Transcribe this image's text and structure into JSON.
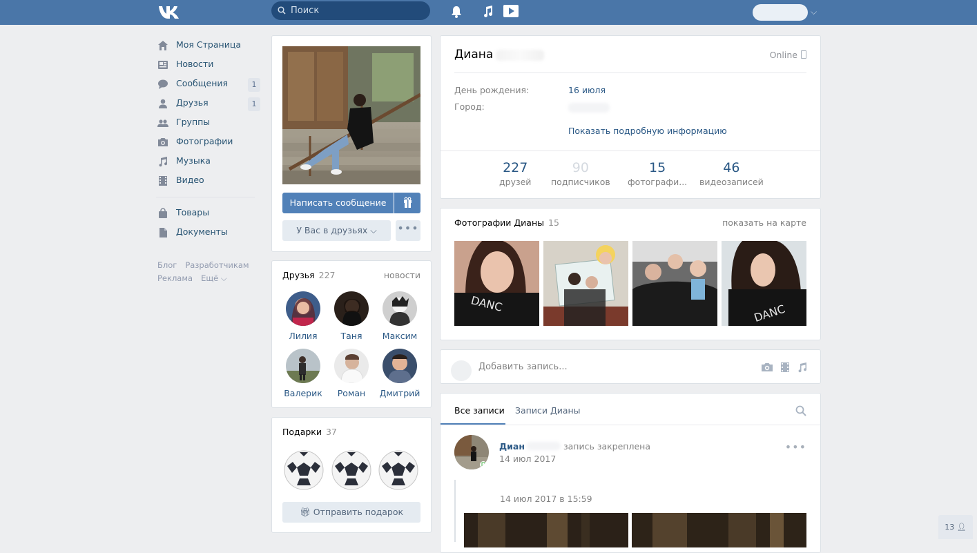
{
  "header": {
    "search_placeholder": "Поиск"
  },
  "nav": {
    "items": [
      {
        "label": "Моя Страница",
        "icon": "home-icon"
      },
      {
        "label": "Новости",
        "icon": "news-icon"
      },
      {
        "label": "Сообщения",
        "icon": "messages-icon",
        "count": "1"
      },
      {
        "label": "Друзья",
        "icon": "friends-icon",
        "count": "1"
      },
      {
        "label": "Группы",
        "icon": "groups-icon"
      },
      {
        "label": "Фотографии",
        "icon": "camera-icon"
      },
      {
        "label": "Музыка",
        "icon": "music-icon"
      },
      {
        "label": "Видео",
        "icon": "video-icon"
      }
    ],
    "items2": [
      {
        "label": "Товары",
        "icon": "bag-icon"
      },
      {
        "label": "Документы",
        "icon": "document-icon"
      }
    ],
    "footer": [
      "Блог",
      "Разработчикам",
      "Реклама",
      "Ещё ⌵"
    ]
  },
  "profile": {
    "write_message": "Написать сообщение",
    "friends_status": "У Вас в друзьях ⌵",
    "more_dots": "•••",
    "name": "Диана",
    "online": "Online",
    "birthday_label": "День рождения:",
    "birthday_value": "16 июля",
    "city_label": "Город:",
    "show_more": "Показать подробную информацию",
    "counters": [
      {
        "value": "227",
        "label": "друзей"
      },
      {
        "value": "90",
        "label": "подписчиков"
      },
      {
        "value": "15",
        "label": "фотографи..."
      },
      {
        "value": "46",
        "label": "видеозаписей"
      }
    ]
  },
  "friends_block": {
    "title": "Друзья",
    "count": "227",
    "link": "новости",
    "friends": [
      "Лилия",
      "Таня",
      "Максим",
      "Валерик",
      "Роман",
      "Дмитрий"
    ]
  },
  "gifts_block": {
    "title": "Подарки",
    "count": "37",
    "send_label": "Отправить подарок"
  },
  "photos_block": {
    "title": "Фотографии Дианы",
    "count": "15",
    "link": "показать на карте"
  },
  "new_post": {
    "placeholder": "Добавить запись..."
  },
  "feed": {
    "tab_all": "Все записи",
    "tab_own": "Записи Дианы",
    "pinned_author": "Диан",
    "pinned_note": "запись закреплена",
    "pinned_date": "14 июл 2017",
    "repost_date": "14 июл 2017 в 15:59"
  },
  "corner_badge": "13"
}
